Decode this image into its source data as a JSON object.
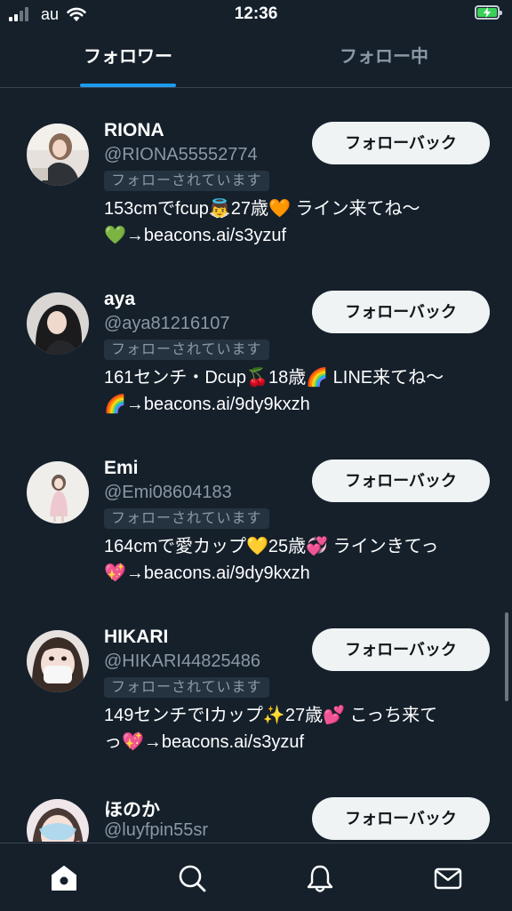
{
  "status_bar": {
    "carrier": "au",
    "time": "12:36"
  },
  "tabs": {
    "followers": "フォロワー",
    "following": "フォロー中"
  },
  "follow_back_label": "フォローバック",
  "follows_you_label": "フォローされています",
  "users": [
    {
      "name": "RIONA",
      "handle": "@RIONA55552774",
      "bio": "153cmでfcup👼27歳🧡 ライン来てね〜\n💚→beacons.ai/s3yzuf",
      "follows_you": true
    },
    {
      "name": "aya",
      "handle": "@aya81216107",
      "bio": "161センチ・Dcup🍒18歳🌈 LINE来てね〜\n🌈→beacons.ai/9dy9kxzh",
      "follows_you": true
    },
    {
      "name": "Emi",
      "handle": "@Emi08604183",
      "bio": "164cmで愛カップ💛25歳💞 ラインきてっ\n💖→beacons.ai/9dy9kxzh",
      "follows_you": true
    },
    {
      "name": "HIKARI",
      "handle": "@HIKARI44825486",
      "bio": "149センチでIカップ✨27歳💕 こっち来て\nっ💖→beacons.ai/s3yzuf",
      "follows_you": true
    },
    {
      "name": "ほのか",
      "handle": "@luyfpin55sr",
      "bio": "",
      "follows_you": false
    }
  ],
  "bottom_nav": [
    "home-icon",
    "search-icon",
    "notifications-icon",
    "messages-icon"
  ],
  "colors": {
    "background": "#15202b",
    "accent": "#1d9bf0",
    "secondary_text": "#8b98a5",
    "button_bg": "#eff3f4"
  }
}
